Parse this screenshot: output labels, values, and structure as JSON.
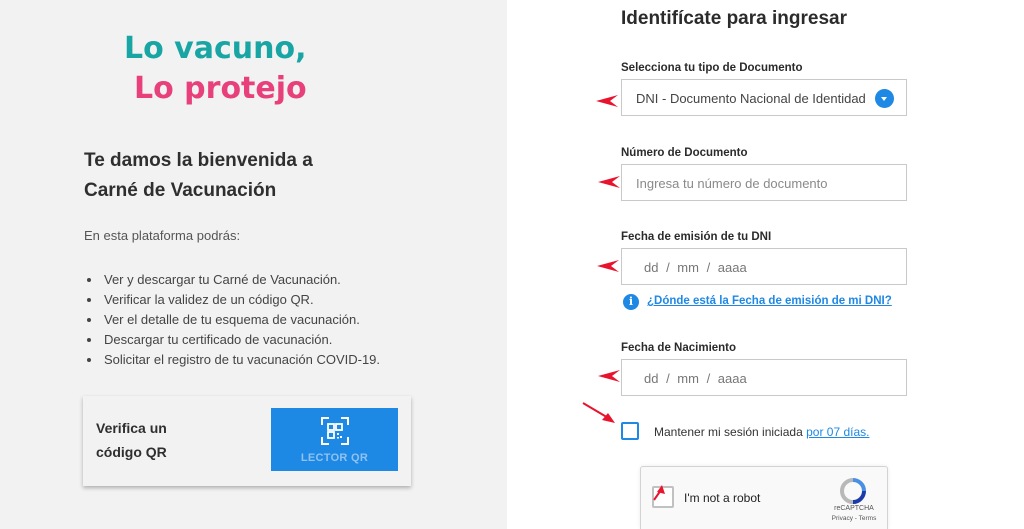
{
  "logo": {
    "line1": "Lo vacuno,",
    "line2": "Lo protejo"
  },
  "welcome": {
    "line1": "Te damos la bienvenida a",
    "line2": "Carné de Vacunación"
  },
  "intro": "En esta plataforma podrás:",
  "features": [
    "Ver y descargar tu Carné de Vacunación.",
    "Verificar la validez de un código QR.",
    "Ver el detalle de tu esquema de vacunación.",
    "Descargar tu certificado de vacunación.",
    "Solicitar el registro de tu vacunación COVID-19."
  ],
  "qr_card": {
    "line1": "Verifica un",
    "line2": "código QR",
    "button_label": "LECTOR QR"
  },
  "form": {
    "title": "Identifícate para ingresar",
    "doc_type": {
      "label": "Selecciona tu tipo de Documento",
      "value": "DNI - Documento Nacional de Identidad"
    },
    "doc_number": {
      "label": "Número de Documento",
      "placeholder": "Ingresa tu número de documento"
    },
    "issue_date": {
      "label": "Fecha de emisión de tu DNI",
      "placeholder": "dd / mm / aaaa"
    },
    "issue_help_link": "¿Dónde está la Fecha de emisión de mi DNI?",
    "birth_date": {
      "label": "Fecha de Nacimiento",
      "placeholder": "dd / mm / aaaa"
    },
    "keep_session": {
      "text": "Mantener mi sesión iniciada",
      "link": "por 07 días."
    }
  },
  "captcha": {
    "label": "I'm not a robot",
    "brand": "reCAPTCHA",
    "terms": "Privacy - Terms"
  },
  "colors": {
    "accent": "#1e88e5",
    "pink": "#e8407a",
    "teal": "#1aa5a5",
    "annotation_red": "#e8142e"
  }
}
